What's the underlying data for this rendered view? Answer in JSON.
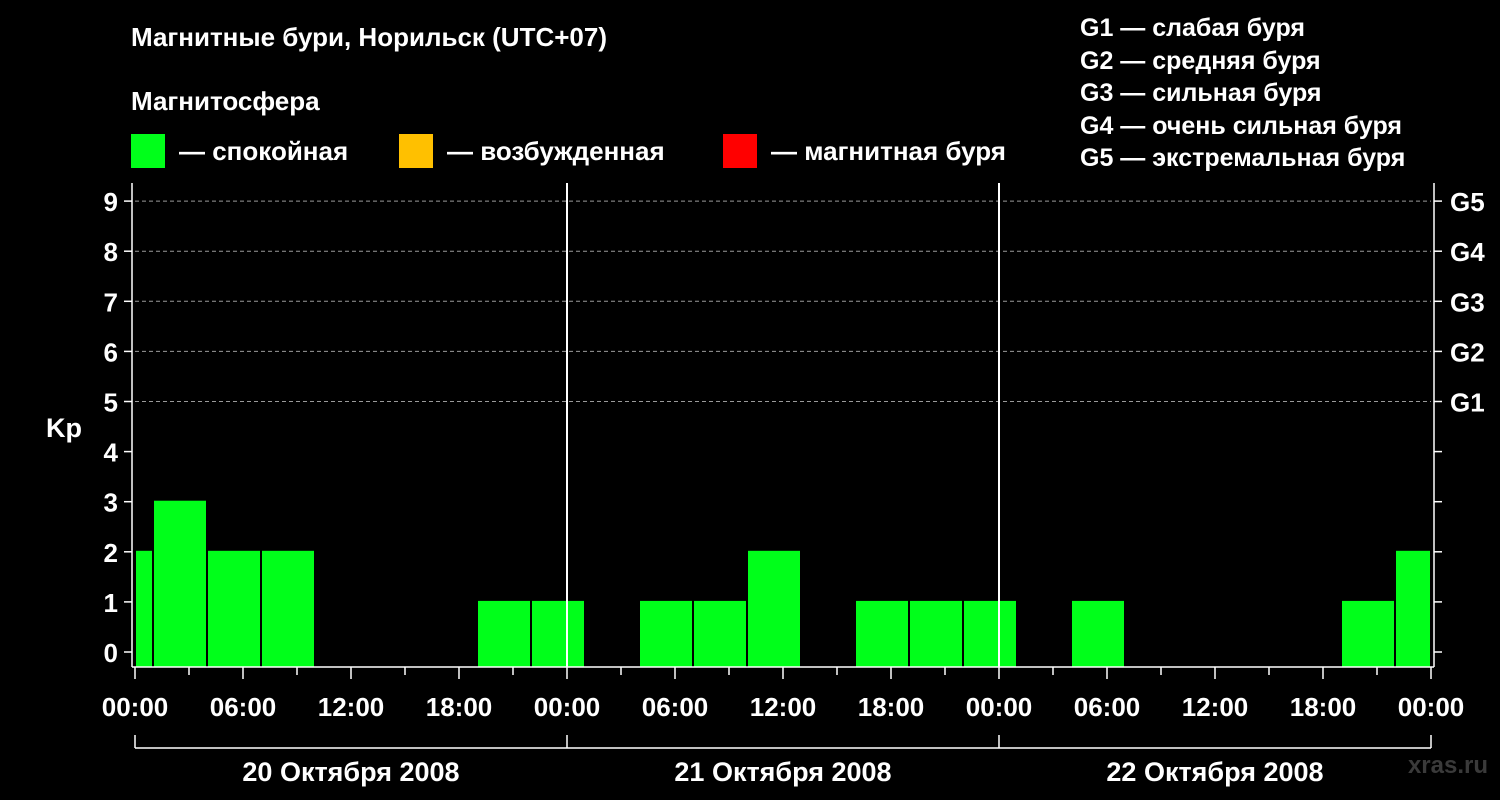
{
  "title": "Магнитные бури, Норильск (UTC+07)",
  "magnetosphere": {
    "title": "Магнитосфера",
    "items": [
      {
        "label": "— спокойная",
        "color": "#00ff1a"
      },
      {
        "label": "— возбужденная",
        "color": "#ffc000"
      },
      {
        "label": "— магнитная буря",
        "color": "#ff0000"
      }
    ]
  },
  "g_legend": [
    "G1 — слабая буря",
    "G2 — средняя буря",
    "G3 — сильная буря",
    "G4 — очень сильная буря",
    "G5 — экстремальная буря"
  ],
  "watermark": "xras.ru",
  "chart_data": {
    "type": "bar",
    "ylabel": "Kp",
    "ylim": [
      0,
      9
    ],
    "yticks": [
      0,
      1,
      2,
      3,
      4,
      5,
      6,
      7,
      8,
      9
    ],
    "right_axis_labels": [
      {
        "kp": 5,
        "label": "G1"
      },
      {
        "kp": 6,
        "label": "G2"
      },
      {
        "kp": 7,
        "label": "G3"
      },
      {
        "kp": 8,
        "label": "G4"
      },
      {
        "kp": 9,
        "label": "G5"
      }
    ],
    "xtick_labels": [
      "00:00",
      "06:00",
      "12:00",
      "18:00",
      "00:00",
      "06:00",
      "12:00",
      "18:00",
      "00:00",
      "06:00",
      "12:00",
      "18:00",
      "00:00"
    ],
    "days": [
      "20 Октября 2008",
      "21 Октября 2008",
      "22 Октября 2008"
    ],
    "bar_color": "#00ff1a",
    "bars": [
      {
        "start_hour": 0,
        "end_hour": 1,
        "kp": 2
      },
      {
        "start_hour": 1,
        "end_hour": 4,
        "kp": 3
      },
      {
        "start_hour": 4,
        "end_hour": 7,
        "kp": 2
      },
      {
        "start_hour": 7,
        "end_hour": 10,
        "kp": 2
      },
      {
        "start_hour": 10,
        "end_hour": 13,
        "kp": 0
      },
      {
        "start_hour": 13,
        "end_hour": 16,
        "kp": 0
      },
      {
        "start_hour": 16,
        "end_hour": 19,
        "kp": 0
      },
      {
        "start_hour": 19,
        "end_hour": 22,
        "kp": 1
      },
      {
        "start_hour": 22,
        "end_hour": 25,
        "kp": 1
      },
      {
        "start_hour": 25,
        "end_hour": 28,
        "kp": 0
      },
      {
        "start_hour": 28,
        "end_hour": 31,
        "kp": 1
      },
      {
        "start_hour": 31,
        "end_hour": 34,
        "kp": 1
      },
      {
        "start_hour": 34,
        "end_hour": 37,
        "kp": 2
      },
      {
        "start_hour": 37,
        "end_hour": 40,
        "kp": 0
      },
      {
        "start_hour": 40,
        "end_hour": 43,
        "kp": 1
      },
      {
        "start_hour": 43,
        "end_hour": 46,
        "kp": 1
      },
      {
        "start_hour": 46,
        "end_hour": 49,
        "kp": 1
      },
      {
        "start_hour": 49,
        "end_hour": 52,
        "kp": 0
      },
      {
        "start_hour": 52,
        "end_hour": 55,
        "kp": 1
      },
      {
        "start_hour": 55,
        "end_hour": 58,
        "kp": 0
      },
      {
        "start_hour": 58,
        "end_hour": 61,
        "kp": 0
      },
      {
        "start_hour": 61,
        "end_hour": 64,
        "kp": 0
      },
      {
        "start_hour": 64,
        "end_hour": 67,
        "kp": 0
      },
      {
        "start_hour": 67,
        "end_hour": 70,
        "kp": 1
      },
      {
        "start_hour": 70,
        "end_hour": 72,
        "kp": 2
      }
    ],
    "grid": "dashed at Kp 5-9"
  }
}
